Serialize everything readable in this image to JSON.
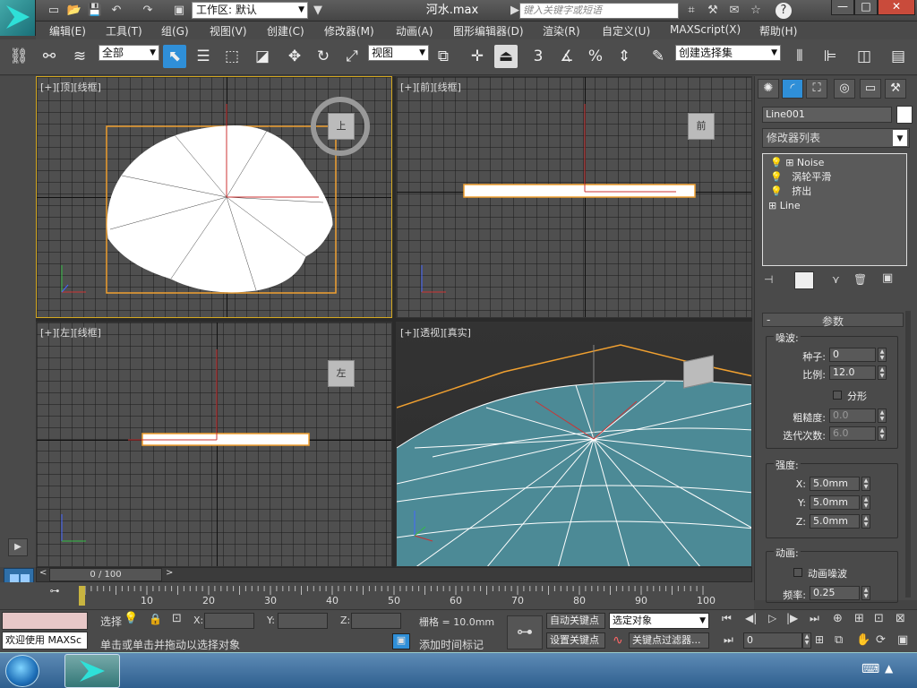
{
  "titlebar": {
    "workspace": "工作区: 默认",
    "title": "河水.max",
    "search_placeholder": "键入关键字或短语",
    "help_label": "?",
    "min_label": "—",
    "max_label": "□",
    "close_label": "✕"
  },
  "menu": [
    "编辑(E)",
    "工具(T)",
    "组(G)",
    "视图(V)",
    "创建(C)",
    "修改器(M)",
    "动画(A)",
    "图形编辑器(D)",
    "渲染(R)",
    "自定义(U)",
    "MAXScript(X)",
    "帮助(H)"
  ],
  "toolbar": {
    "selection_filter": "全部",
    "ref_coord": "视图",
    "named_selection": "创建选择集",
    "snap_3": "3",
    "percent": "%"
  },
  "viewports": {
    "top": {
      "label": "[+][顶][线框]",
      "cube": "上"
    },
    "front": {
      "label": "[+][前][线框]",
      "cube": "前"
    },
    "left": {
      "label": "[+][左][线框]",
      "cube": "左"
    },
    "persp": {
      "label": "[+][透视][真实]"
    }
  },
  "panel": {
    "object_name": "Line001",
    "modifier_list": "修改器列表",
    "stack": [
      "Noise",
      "涡轮平滑",
      "挤出",
      "Line"
    ],
    "rollout_title": "参数",
    "noise_group": "噪波:",
    "seed_label": "种子:",
    "seed_value": "0",
    "scale_label": "比例:",
    "scale_value": "12.0",
    "fractal_label": "分形",
    "roughness_label": "粗糙度:",
    "roughness_value": "0.0",
    "iterations_label": "迭代次数:",
    "iterations_value": "6.0",
    "strength_group": "强度:",
    "x_label": "X:",
    "x_value": "5.0mm",
    "y_label": "Y:",
    "y_value": "5.0mm",
    "z_label": "Z:",
    "z_value": "5.0mm",
    "anim_group": "动画:",
    "anim_noise_label": "动画噪波",
    "freq_label": "频率:",
    "freq_value": "0.25"
  },
  "timeslider": {
    "value": "0 / 100",
    "progress": 0
  },
  "trackbar": {
    "ticks": [
      "10",
      "20",
      "30",
      "40",
      "50",
      "60",
      "70",
      "80",
      "90",
      "100"
    ]
  },
  "status": {
    "welcome": "欢迎使用 MAXSc",
    "selected_label": "选择",
    "prompt": "单击或单击并拖动以选择对象",
    "x_label": "X:",
    "y_label": "Y:",
    "z_label": "Z:",
    "grid": "栅格 = 10.0mm",
    "add_time_tag": "添加时间标记",
    "auto_key": "自动关键点",
    "set_key": "设置关键点",
    "key_mode": "选定对象",
    "key_filters": "关键点过滤器...",
    "frame": "0"
  },
  "colors": {
    "accent": "#2f8fd8",
    "selection": "#f0a030",
    "viewport_bg": "#4f4f4f"
  }
}
